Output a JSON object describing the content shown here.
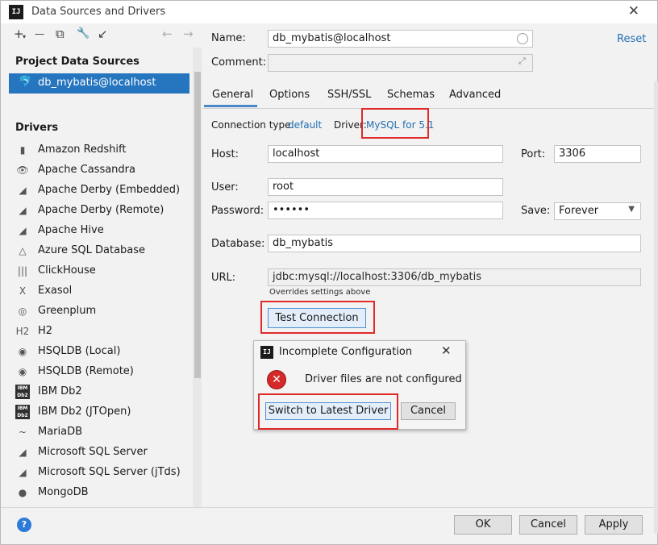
{
  "window": {
    "logo": "IJ",
    "title": "Data Sources and Drivers",
    "close": "✕"
  },
  "toolbar": {
    "add": "+",
    "add_caret": "▾",
    "remove": "—",
    "duplicate": "⧉",
    "wrench": "🔧",
    "goto": "↙",
    "back": "←",
    "forward": "→"
  },
  "sidebar": {
    "project_title": "Project Data Sources",
    "project_item": "db_mybatis@localhost",
    "drivers_title": "Drivers",
    "drivers": [
      {
        "label": "Amazon Redshift",
        "icon": "▮"
      },
      {
        "label": "Apache Cassandra",
        "icon": "👁"
      },
      {
        "label": "Apache Derby (Embedded)",
        "icon": "◢"
      },
      {
        "label": "Apache Derby (Remote)",
        "icon": "◢"
      },
      {
        "label": "Apache Hive",
        "icon": "◢"
      },
      {
        "label": "Azure SQL Database",
        "icon": "△"
      },
      {
        "label": "ClickHouse",
        "icon": "|||"
      },
      {
        "label": "Exasol",
        "icon": "X"
      },
      {
        "label": "Greenplum",
        "icon": "◎"
      },
      {
        "label": "H2",
        "icon": "H2"
      },
      {
        "label": "HSQLDB (Local)",
        "icon": "◉"
      },
      {
        "label": "HSQLDB (Remote)",
        "icon": "◉"
      },
      {
        "label": "IBM Db2",
        "icon": "IBM Db2"
      },
      {
        "label": "IBM Db2 (JTOpen)",
        "icon": "IBM Db2"
      },
      {
        "label": "MariaDB",
        "icon": "~"
      },
      {
        "label": "Microsoft SQL Server",
        "icon": "◢"
      },
      {
        "label": "Microsoft SQL Server (jTds)",
        "icon": "◢"
      },
      {
        "label": "MongoDB",
        "icon": "●"
      }
    ]
  },
  "form": {
    "name_label": "Name:",
    "name_value": "db_mybatis@localhost",
    "comment_label": "Comment:",
    "comment_value": "",
    "reset": "Reset",
    "tabs": [
      "General",
      "Options",
      "SSH/SSL",
      "Schemas",
      "Advanced"
    ],
    "connection_type_label": "Connection type:",
    "connection_type_value": "default",
    "driver_label": "Driver:",
    "driver_value": "MySQL for 5.1",
    "host_label": "Host:",
    "host_value": "localhost",
    "port_label": "Port:",
    "port_value": "3306",
    "user_label": "User:",
    "user_value": "root",
    "password_label": "Password:",
    "password_value": "••••••",
    "save_label": "Save:",
    "save_value": "Forever",
    "database_label": "Database:",
    "database_value": "db_mybatis",
    "url_label": "URL:",
    "url_value": "jdbc:mysql://localhost:3306/db_mybatis",
    "url_note": "Overrides settings above",
    "test_connection": "Test Connection"
  },
  "popup": {
    "logo": "IJ",
    "title": "Incomplete Configuration",
    "close": "✕",
    "message": "Driver files are not configured",
    "switch_button": "Switch to Latest Driver",
    "cancel_button": "Cancel"
  },
  "footer": {
    "help": "?",
    "ok": "OK",
    "cancel": "Cancel",
    "apply": "Apply"
  },
  "colors": {
    "accent": "#2675bf",
    "link": "#2470b3",
    "highlight_box": "#e02a2a",
    "error": "#d42a2a"
  }
}
